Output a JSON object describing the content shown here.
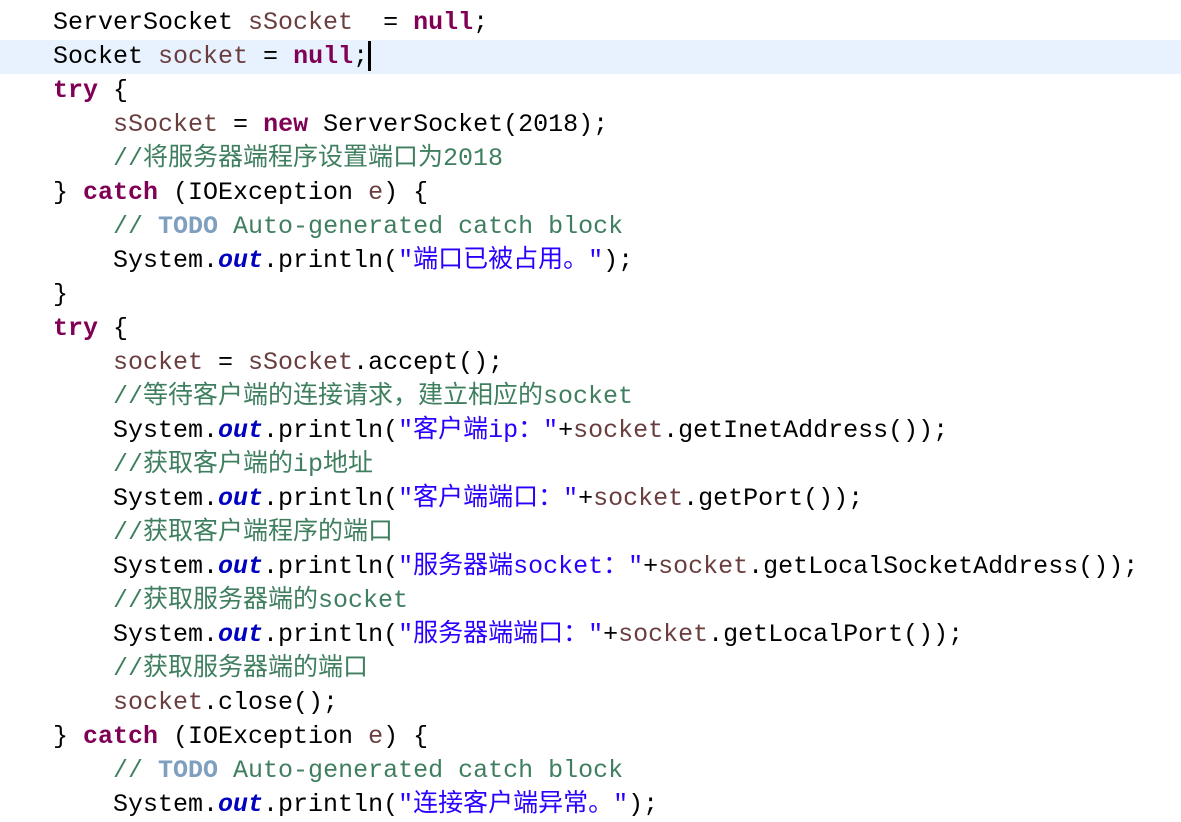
{
  "editor": {
    "current_line": 1,
    "colors": {
      "keyword": "#7f0055",
      "variable": "#6a3e3e",
      "comment": "#3f7f5f",
      "todo": "#7f9fbf",
      "field": "#0000c0",
      "string": "#2a00ff",
      "current_line_bg": "#e8f2fe"
    },
    "lines": [
      {
        "tokens": [
          [
            "pl",
            "ServerSocket "
          ],
          [
            "var",
            "sSocket"
          ],
          [
            "pl",
            "  = "
          ],
          [
            "kw",
            "null"
          ],
          [
            "pl",
            ";"
          ]
        ]
      },
      {
        "tokens": [
          [
            "pl",
            "Socket "
          ],
          [
            "var",
            "socket"
          ],
          [
            "pl",
            " = "
          ],
          [
            "kw",
            "null"
          ],
          [
            "pl",
            ";"
          ]
        ]
      },
      {
        "tokens": [
          [
            "kw",
            "try"
          ],
          [
            "pl",
            " {"
          ]
        ]
      },
      {
        "tokens": [
          [
            "pl",
            "    "
          ],
          [
            "var",
            "sSocket"
          ],
          [
            "pl",
            " = "
          ],
          [
            "kw",
            "new"
          ],
          [
            "pl",
            " ServerSocket(2018);"
          ]
        ]
      },
      {
        "tokens": [
          [
            "pl",
            "    "
          ],
          [
            "cm",
            "//将服务器端程序设置端口为2018"
          ]
        ]
      },
      {
        "tokens": [
          [
            "pl",
            "} "
          ],
          [
            "kw",
            "catch"
          ],
          [
            "pl",
            " (IOException "
          ],
          [
            "var",
            "e"
          ],
          [
            "pl",
            ") {"
          ]
        ]
      },
      {
        "tokens": [
          [
            "pl",
            "    "
          ],
          [
            "cm",
            "// "
          ],
          [
            "todo",
            "TODO"
          ],
          [
            "cm",
            " Auto-generated catch block"
          ]
        ]
      },
      {
        "tokens": [
          [
            "pl",
            "    System."
          ],
          [
            "fld",
            "out"
          ],
          [
            "pl",
            ".println("
          ],
          [
            "str",
            "\"端口已被占用。\""
          ],
          [
            "pl",
            ");"
          ]
        ]
      },
      {
        "tokens": [
          [
            "pl",
            "}"
          ]
        ]
      },
      {
        "tokens": [
          [
            "kw",
            "try"
          ],
          [
            "pl",
            " {"
          ]
        ]
      },
      {
        "tokens": [
          [
            "pl",
            "    "
          ],
          [
            "var",
            "socket"
          ],
          [
            "pl",
            " = "
          ],
          [
            "var",
            "sSocket"
          ],
          [
            "pl",
            ".accept();"
          ]
        ]
      },
      {
        "tokens": [
          [
            "pl",
            "    "
          ],
          [
            "cm",
            "//等待客户端的连接请求，建立相应的socket"
          ]
        ]
      },
      {
        "tokens": [
          [
            "pl",
            "    System."
          ],
          [
            "fld",
            "out"
          ],
          [
            "pl",
            ".println("
          ],
          [
            "str",
            "\"客户端ip：\""
          ],
          [
            "pl",
            "+"
          ],
          [
            "var",
            "socket"
          ],
          [
            "pl",
            ".getInetAddress());"
          ]
        ]
      },
      {
        "tokens": [
          [
            "pl",
            "    "
          ],
          [
            "cm",
            "//获取客户端的ip地址"
          ]
        ]
      },
      {
        "tokens": [
          [
            "pl",
            "    System."
          ],
          [
            "fld",
            "out"
          ],
          [
            "pl",
            ".println("
          ],
          [
            "str",
            "\"客户端端口：\""
          ],
          [
            "pl",
            "+"
          ],
          [
            "var",
            "socket"
          ],
          [
            "pl",
            ".getPort());"
          ]
        ]
      },
      {
        "tokens": [
          [
            "pl",
            "    "
          ],
          [
            "cm",
            "//获取客户端程序的端口"
          ]
        ]
      },
      {
        "tokens": [
          [
            "pl",
            "    System."
          ],
          [
            "fld",
            "out"
          ],
          [
            "pl",
            ".println("
          ],
          [
            "str",
            "\"服务器端socket：\""
          ],
          [
            "pl",
            "+"
          ],
          [
            "var",
            "socket"
          ],
          [
            "pl",
            ".getLocalSocketAddress());"
          ]
        ]
      },
      {
        "tokens": [
          [
            "pl",
            "    "
          ],
          [
            "cm",
            "//获取服务器端的socket"
          ]
        ]
      },
      {
        "tokens": [
          [
            "pl",
            "    System."
          ],
          [
            "fld",
            "out"
          ],
          [
            "pl",
            ".println("
          ],
          [
            "str",
            "\"服务器端端口：\""
          ],
          [
            "pl",
            "+"
          ],
          [
            "var",
            "socket"
          ],
          [
            "pl",
            ".getLocalPort());"
          ]
        ]
      },
      {
        "tokens": [
          [
            "pl",
            "    "
          ],
          [
            "cm",
            "//获取服务器端的端口"
          ]
        ]
      },
      {
        "tokens": [
          [
            "pl",
            "    "
          ],
          [
            "var",
            "socket"
          ],
          [
            "pl",
            ".close();"
          ]
        ]
      },
      {
        "tokens": [
          [
            "pl",
            "} "
          ],
          [
            "kw",
            "catch"
          ],
          [
            "pl",
            " (IOException "
          ],
          [
            "var",
            "e"
          ],
          [
            "pl",
            ") {"
          ]
        ]
      },
      {
        "tokens": [
          [
            "pl",
            "    "
          ],
          [
            "cm",
            "// "
          ],
          [
            "todo",
            "TODO"
          ],
          [
            "cm",
            " Auto-generated catch block"
          ]
        ]
      },
      {
        "tokens": [
          [
            "pl",
            "    System."
          ],
          [
            "fld",
            "out"
          ],
          [
            "pl",
            ".println("
          ],
          [
            "str",
            "\"连接客户端异常。\""
          ],
          [
            "pl",
            ");"
          ]
        ]
      }
    ]
  }
}
